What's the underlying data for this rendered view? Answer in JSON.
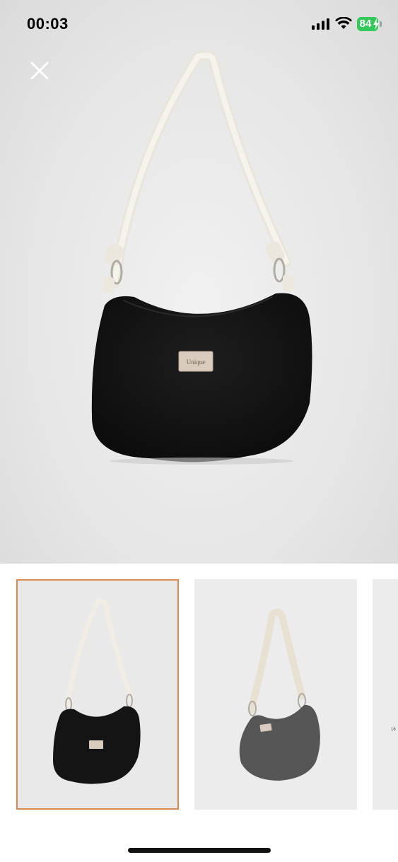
{
  "status_bar": {
    "time": "00:03",
    "battery_level": "84"
  },
  "product": {
    "label_text": "Unique"
  },
  "thumbnails": {
    "selected_index": 0,
    "third_peek_text": "16"
  },
  "colors": {
    "selected_border": "#d88a50",
    "battery_green": "#34c759",
    "bag_black": "#141414",
    "bag_grey": "#555555",
    "strap_cream": "#efebe1"
  }
}
